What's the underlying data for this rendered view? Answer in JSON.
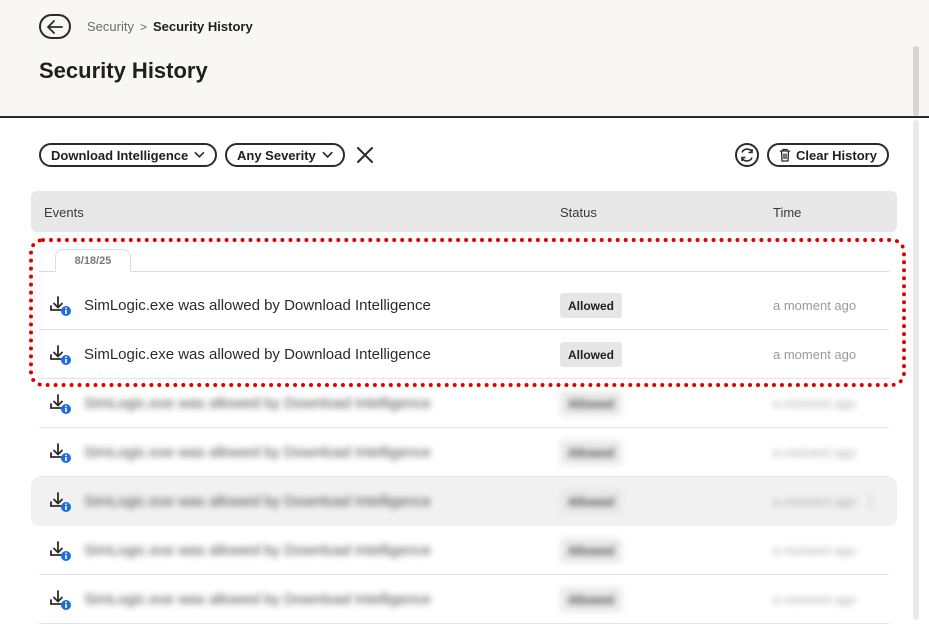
{
  "header": {
    "back_icon": "arrow-left-icon",
    "breadcrumb": {
      "parent": "Security",
      "separator": ">",
      "current": "Security History"
    },
    "title": "Security History"
  },
  "toolbar": {
    "filters": [
      {
        "label": "Download Intelligence",
        "icon": "chevron-down-icon"
      },
      {
        "label": "Any Severity",
        "icon": "chevron-down-icon"
      }
    ],
    "clear_filters_icon": "close-icon",
    "refresh_icon": "refresh-icon",
    "clear_history_label": "Clear History",
    "clear_history_icon": "trash-icon"
  },
  "table": {
    "columns": [
      "Events",
      "Status",
      "Time"
    ],
    "date_group": "8/18/25",
    "rows": [
      {
        "event": "SimLogic.exe was allowed by Download Intelligence",
        "status": "Allowed",
        "time": "a moment ago",
        "icon": "download-info-icon"
      },
      {
        "event": "SimLogic.exe was allowed by Download Intelligence",
        "status": "Allowed",
        "time": "a moment ago",
        "icon": "download-info-icon"
      },
      {
        "event": "SimLogic.exe was allowed by Download Intelligence",
        "status": "Allowed",
        "time": "a moment ago",
        "icon": "download-info-icon"
      },
      {
        "event": "SimLogic.exe was allowed by Download Intelligence",
        "status": "Allowed",
        "time": "a moment ago",
        "icon": "download-info-icon"
      },
      {
        "event": "SimLogic.exe was allowed by Download Intelligence",
        "status": "Allowed",
        "time": "a moment ago",
        "icon": "download-info-icon"
      },
      {
        "event": "SimLogic.exe was allowed by Download Intelligence",
        "status": "Allowed",
        "time": "a moment ago",
        "icon": "download-info-icon"
      },
      {
        "event": "SimLogic.exe was allowed by Download Intelligence",
        "status": "Allowed",
        "time": "a moment ago",
        "icon": "download-info-icon"
      }
    ]
  },
  "colors": {
    "accent_info": "#1a6fe0",
    "highlight": "#e00000",
    "header_bg": "#f8f7f5"
  }
}
